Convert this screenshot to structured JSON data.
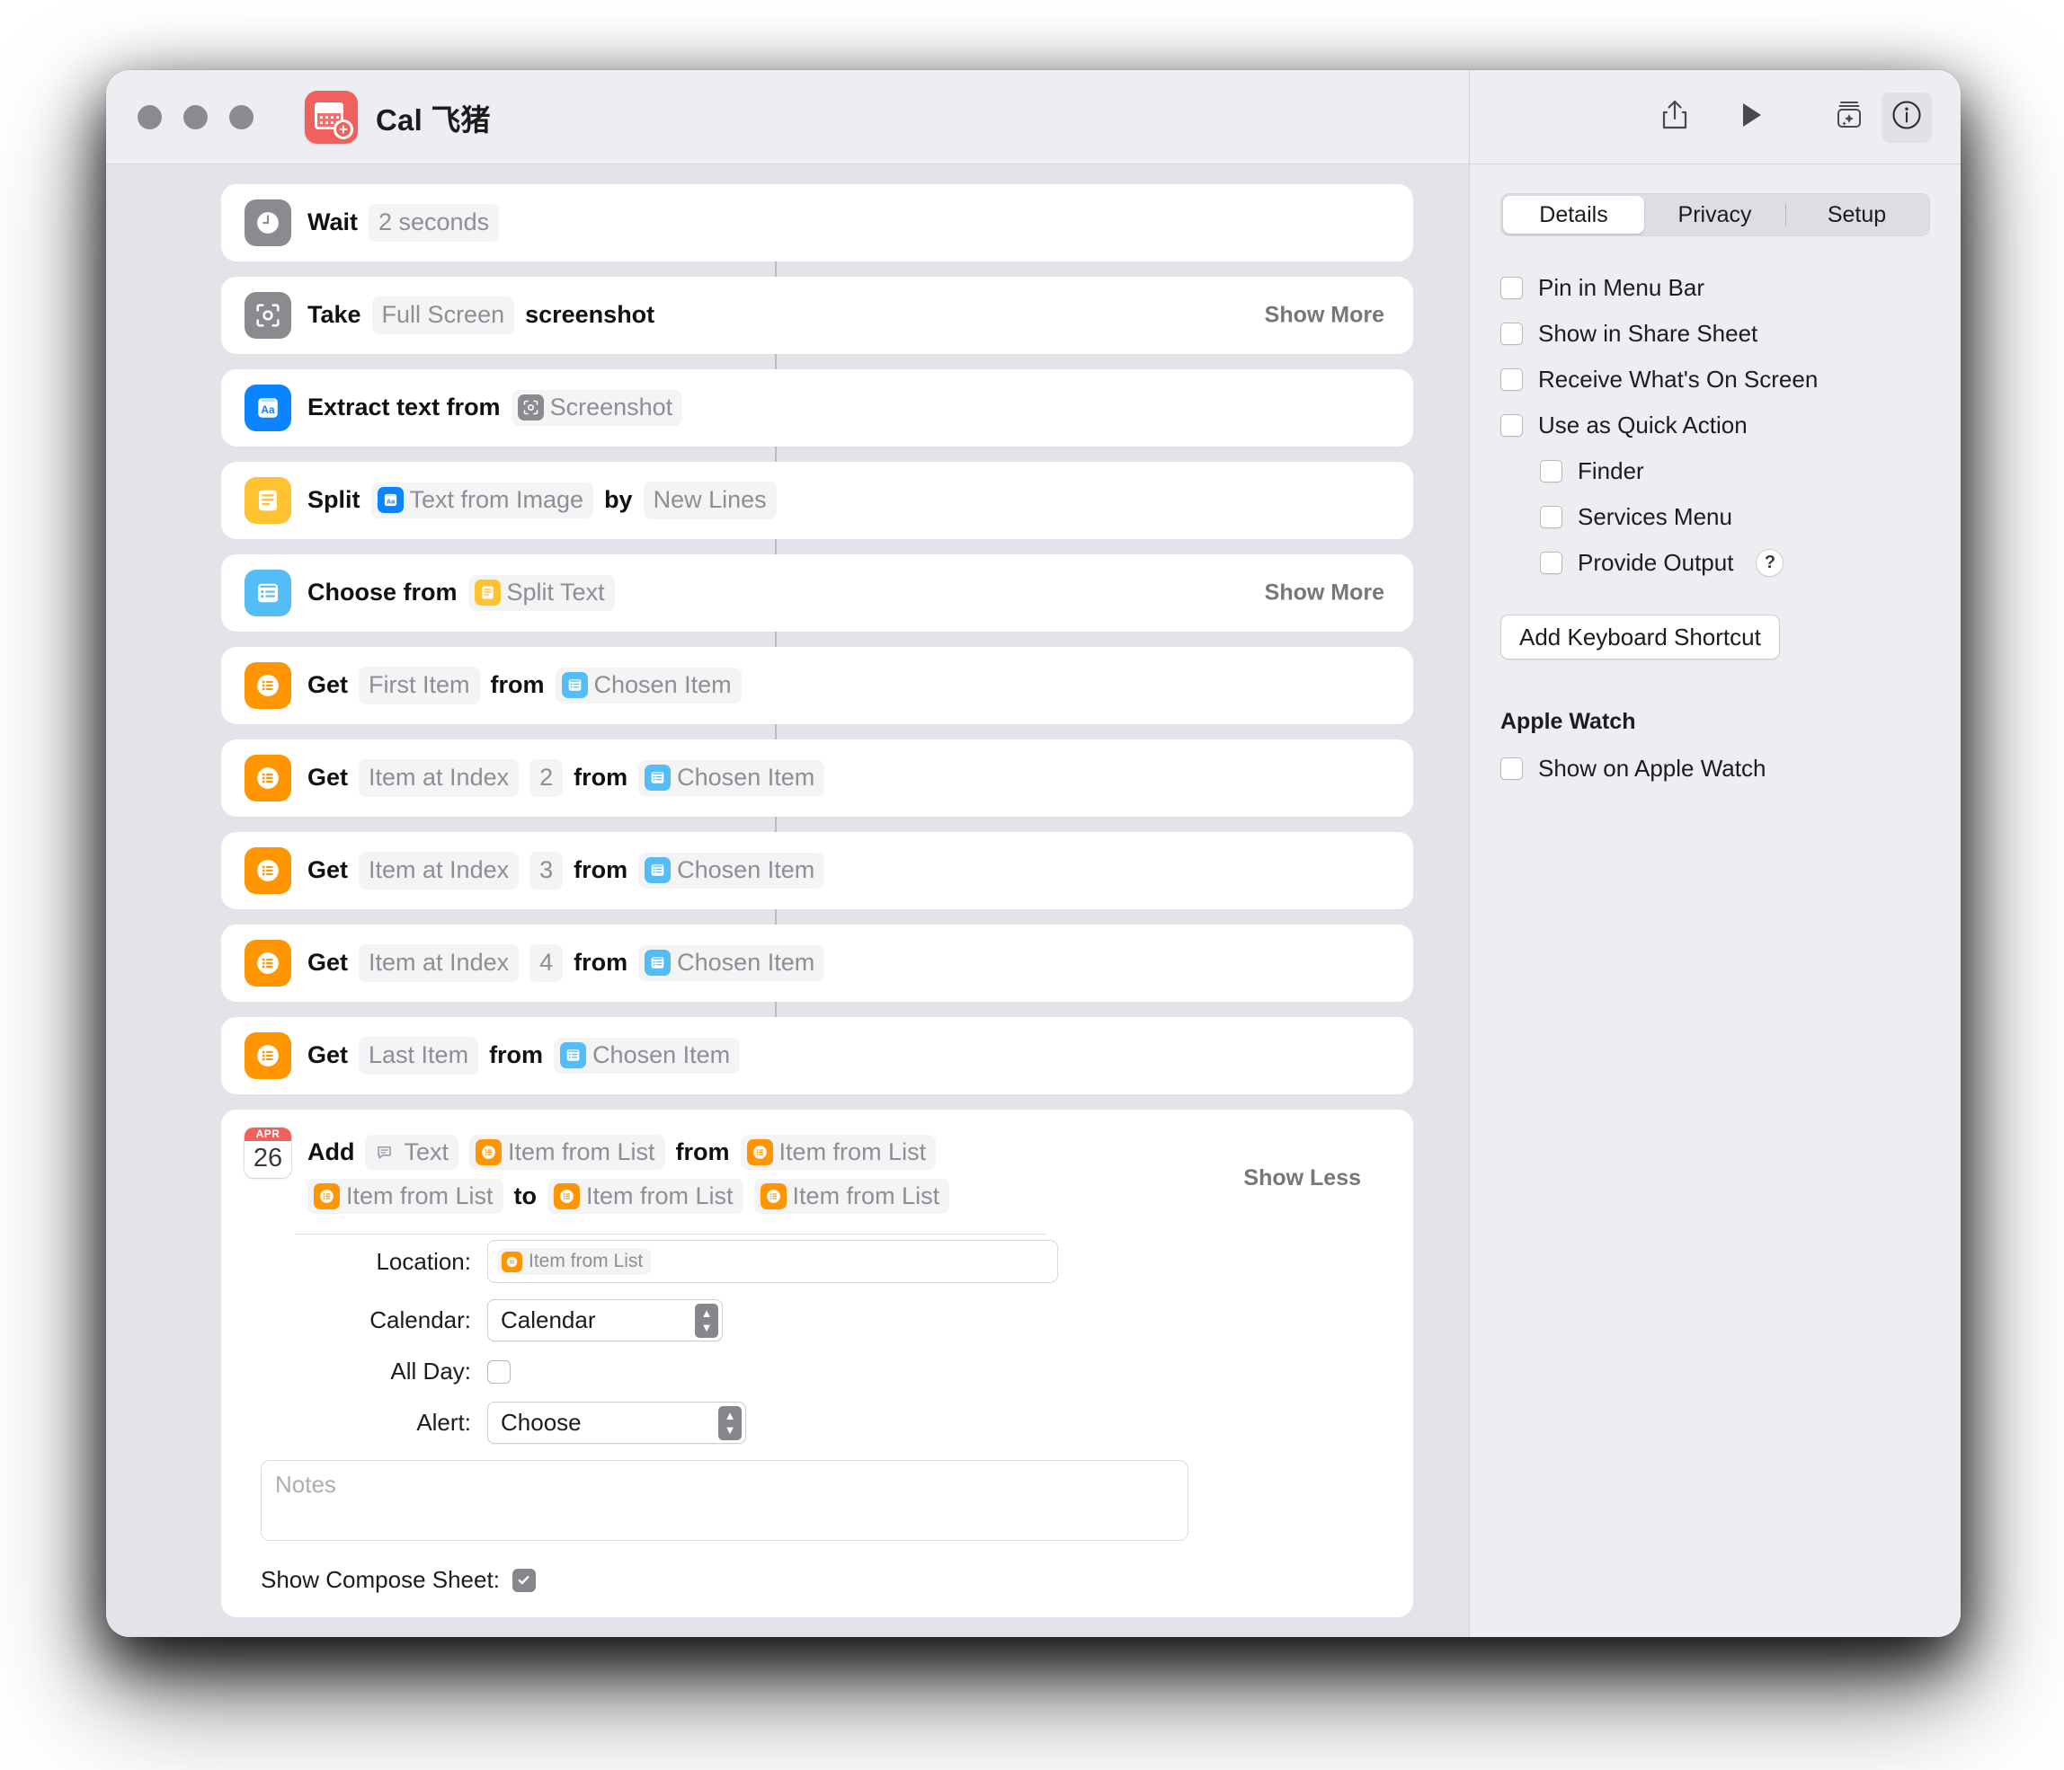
{
  "window": {
    "title": "Cal 飞猪",
    "app_icon": "calendar-add-icon",
    "traffic_lights": [
      "close",
      "minimize",
      "zoom"
    ]
  },
  "toolbar": {
    "share_icon": "share-icon",
    "run_icon": "play-icon",
    "library_icon": "action-library-icon",
    "info_icon": "info-icon"
  },
  "canvas": {
    "actions": [
      {
        "icon": "clock-icon",
        "icon_color": "#8b8b8f",
        "parts": [
          {
            "type": "kw",
            "text": "Wait"
          },
          {
            "type": "param",
            "text": "2 seconds"
          }
        ],
        "toggle": ""
      },
      {
        "icon": "screenshot-icon",
        "icon_color": "#8b8b8f",
        "parts": [
          {
            "type": "kw",
            "text": "Take"
          },
          {
            "type": "param",
            "text": "Full Screen"
          },
          {
            "type": "kw",
            "text": "screenshot"
          }
        ],
        "toggle": "Show More"
      },
      {
        "icon": "text-recognition-icon",
        "icon_color": "#0b84ff",
        "parts": [
          {
            "type": "kw",
            "text": "Extract text from"
          },
          {
            "type": "token",
            "text": "Screenshot",
            "tok_icon": "screenshot-icon",
            "tok_color": "#8b8b8f"
          }
        ],
        "toggle": ""
      },
      {
        "icon": "text-icon",
        "icon_color": "#ffc230",
        "parts": [
          {
            "type": "kw",
            "text": "Split"
          },
          {
            "type": "token",
            "text": "Text from Image",
            "tok_icon": "text-recognition-icon",
            "tok_color": "#0b84ff"
          },
          {
            "type": "kw",
            "text": "by"
          },
          {
            "type": "param",
            "text": "New Lines"
          }
        ],
        "toggle": ""
      },
      {
        "icon": "list-choose-icon",
        "icon_color": "#54bdf5",
        "parts": [
          {
            "type": "kw",
            "text": "Choose from"
          },
          {
            "type": "token",
            "text": "Split Text",
            "tok_icon": "text-icon",
            "tok_color": "#ffc230"
          }
        ],
        "toggle": "Show More"
      },
      {
        "icon": "list-icon",
        "icon_color": "#ff9500",
        "parts": [
          {
            "type": "kw",
            "text": "Get"
          },
          {
            "type": "param",
            "text": "First Item"
          },
          {
            "type": "kw",
            "text": "from"
          },
          {
            "type": "token",
            "text": "Chosen Item",
            "tok_icon": "list-choose-icon",
            "tok_color": "#54bdf5"
          }
        ],
        "toggle": ""
      },
      {
        "icon": "list-icon",
        "icon_color": "#ff9500",
        "parts": [
          {
            "type": "kw",
            "text": "Get"
          },
          {
            "type": "param",
            "text": "Item at Index"
          },
          {
            "type": "num",
            "text": "2"
          },
          {
            "type": "kw",
            "text": "from"
          },
          {
            "type": "token",
            "text": "Chosen Item",
            "tok_icon": "list-choose-icon",
            "tok_color": "#54bdf5"
          }
        ],
        "toggle": ""
      },
      {
        "icon": "list-icon",
        "icon_color": "#ff9500",
        "parts": [
          {
            "type": "kw",
            "text": "Get"
          },
          {
            "type": "param",
            "text": "Item at Index"
          },
          {
            "type": "num",
            "text": "3"
          },
          {
            "type": "kw",
            "text": "from"
          },
          {
            "type": "token",
            "text": "Chosen Item",
            "tok_icon": "list-choose-icon",
            "tok_color": "#54bdf5"
          }
        ],
        "toggle": ""
      },
      {
        "icon": "list-icon",
        "icon_color": "#ff9500",
        "parts": [
          {
            "type": "kw",
            "text": "Get"
          },
          {
            "type": "param",
            "text": "Item at Index"
          },
          {
            "type": "num",
            "text": "4"
          },
          {
            "type": "kw",
            "text": "from"
          },
          {
            "type": "token",
            "text": "Chosen Item",
            "tok_icon": "list-choose-icon",
            "tok_color": "#54bdf5"
          }
        ],
        "toggle": ""
      },
      {
        "icon": "list-icon",
        "icon_color": "#ff9500",
        "parts": [
          {
            "type": "kw",
            "text": "Get"
          },
          {
            "type": "param",
            "text": "Last Item"
          },
          {
            "type": "kw",
            "text": "from"
          },
          {
            "type": "token",
            "text": "Chosen Item",
            "tok_icon": "list-choose-icon",
            "tok_color": "#54bdf5"
          }
        ],
        "toggle": ""
      }
    ],
    "add_event": {
      "icon": {
        "month": "APR",
        "day": "26"
      },
      "line1": [
        {
          "type": "kw",
          "text": "Add"
        },
        {
          "type": "token",
          "text": "Text",
          "tok_icon": "text-bubble-icon",
          "tok_color": "transparent"
        },
        {
          "type": "token",
          "text": "Item from List",
          "tok_icon": "list-icon",
          "tok_color": "#ff9500"
        },
        {
          "type": "kw",
          "text": "from"
        },
        {
          "type": "token",
          "text": "Item from List",
          "tok_icon": "list-icon",
          "tok_color": "#ff9500"
        }
      ],
      "line2": [
        {
          "type": "token",
          "text": "Item from List",
          "tok_icon": "list-icon",
          "tok_color": "#ff9500"
        },
        {
          "type": "kw",
          "text": "to"
        },
        {
          "type": "token",
          "text": "Item from List",
          "tok_icon": "list-icon",
          "tok_color": "#ff9500"
        },
        {
          "type": "token",
          "text": "Item from List",
          "tok_icon": "list-icon",
          "tok_color": "#ff9500"
        }
      ],
      "toggle": "Show Less",
      "fields": {
        "location_label": "Location:",
        "location_token": "Item from List",
        "calendar_label": "Calendar:",
        "calendar_value": "Calendar",
        "allday_label": "All Day:",
        "allday_checked": false,
        "alert_label": "Alert:",
        "alert_value": "Choose",
        "notes_placeholder": "Notes",
        "compose_label": "Show Compose Sheet:",
        "compose_checked": true
      }
    }
  },
  "inspector": {
    "tabs": [
      {
        "label": "Details",
        "selected": true
      },
      {
        "label": "Privacy",
        "selected": false
      },
      {
        "label": "Setup",
        "selected": false
      }
    ],
    "options": [
      {
        "label": "Pin in Menu Bar",
        "checked": false,
        "indent": false
      },
      {
        "label": "Show in Share Sheet",
        "checked": false,
        "indent": false
      },
      {
        "label": "Receive What's On Screen",
        "checked": false,
        "indent": false
      },
      {
        "label": "Use as Quick Action",
        "checked": false,
        "indent": false
      },
      {
        "label": "Finder",
        "checked": false,
        "indent": true
      },
      {
        "label": "Services Menu",
        "checked": false,
        "indent": true
      },
      {
        "label": "Provide Output",
        "checked": false,
        "indent": true,
        "help": "?"
      }
    ],
    "keyboard_shortcut_button": "Add Keyboard Shortcut",
    "apple_watch_section": "Apple Watch",
    "apple_watch_option": {
      "label": "Show on Apple Watch",
      "checked": false
    }
  }
}
